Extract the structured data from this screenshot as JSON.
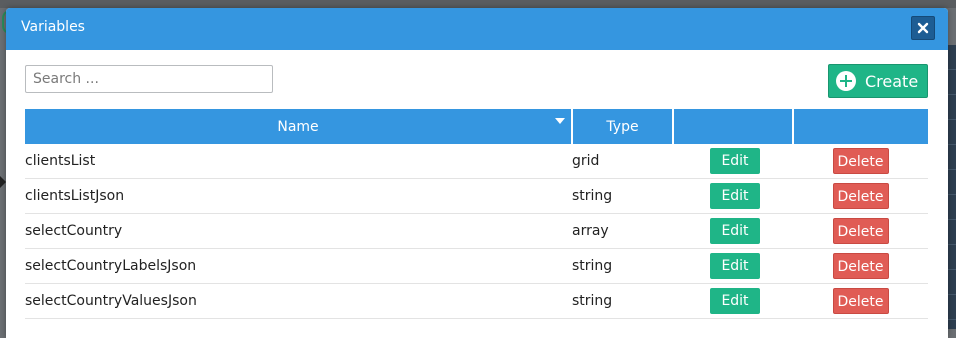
{
  "modal": {
    "title": "Variables",
    "search_placeholder": "Search ...",
    "create_label": "Create"
  },
  "table": {
    "headers": {
      "name": "Name",
      "type": "Type",
      "edit": "",
      "delete": ""
    },
    "rows": [
      {
        "name": "clientsList",
        "type": "grid",
        "edit": "Edit",
        "delete": "Delete"
      },
      {
        "name": "clientsListJson",
        "type": "string",
        "edit": "Edit",
        "delete": "Delete"
      },
      {
        "name": "selectCountry",
        "type": "array",
        "edit": "Edit",
        "delete": "Delete"
      },
      {
        "name": "selectCountryLabelsJson",
        "type": "string",
        "edit": "Edit",
        "delete": "Delete"
      },
      {
        "name": "selectCountryValuesJson",
        "type": "string",
        "edit": "Edit",
        "delete": "Delete"
      }
    ]
  },
  "colors": {
    "header_blue": "#3596e0",
    "create_green": "#1fb587",
    "delete_red": "#e05c55"
  },
  "icons": {
    "close": "close-icon",
    "create": "plus-circle-icon",
    "sort": "sort-down-icon"
  }
}
